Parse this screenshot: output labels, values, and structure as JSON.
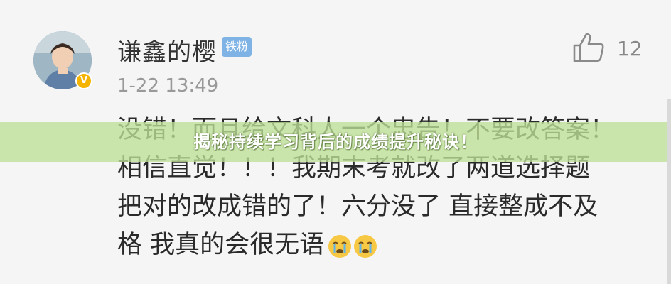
{
  "comment": {
    "username": "谦鑫的樱",
    "fan_badge": "铁粉",
    "verified_mark": "V",
    "timestamp": "1-22 13:49",
    "like_icon": "thumbs-up-icon",
    "like_count": "12",
    "lines": [
      "没错！而且给文科人一个忠告！不要改答案！",
      "相信直觉！！！我期末考就改了两道选择题",
      "把对的改成错的了！六分没了 直接整成不及",
      "格 我真的会很无语"
    ],
    "emojis": [
      "crying-emoji",
      "crying-emoji"
    ]
  },
  "banner": {
    "title": "揭秘持续学习背后的成绩提升秘诀！"
  },
  "colors": {
    "banner_bg": "#bee096",
    "fan_badge_bg": "#7fb3e6",
    "verified_badge": "#f5b400"
  }
}
